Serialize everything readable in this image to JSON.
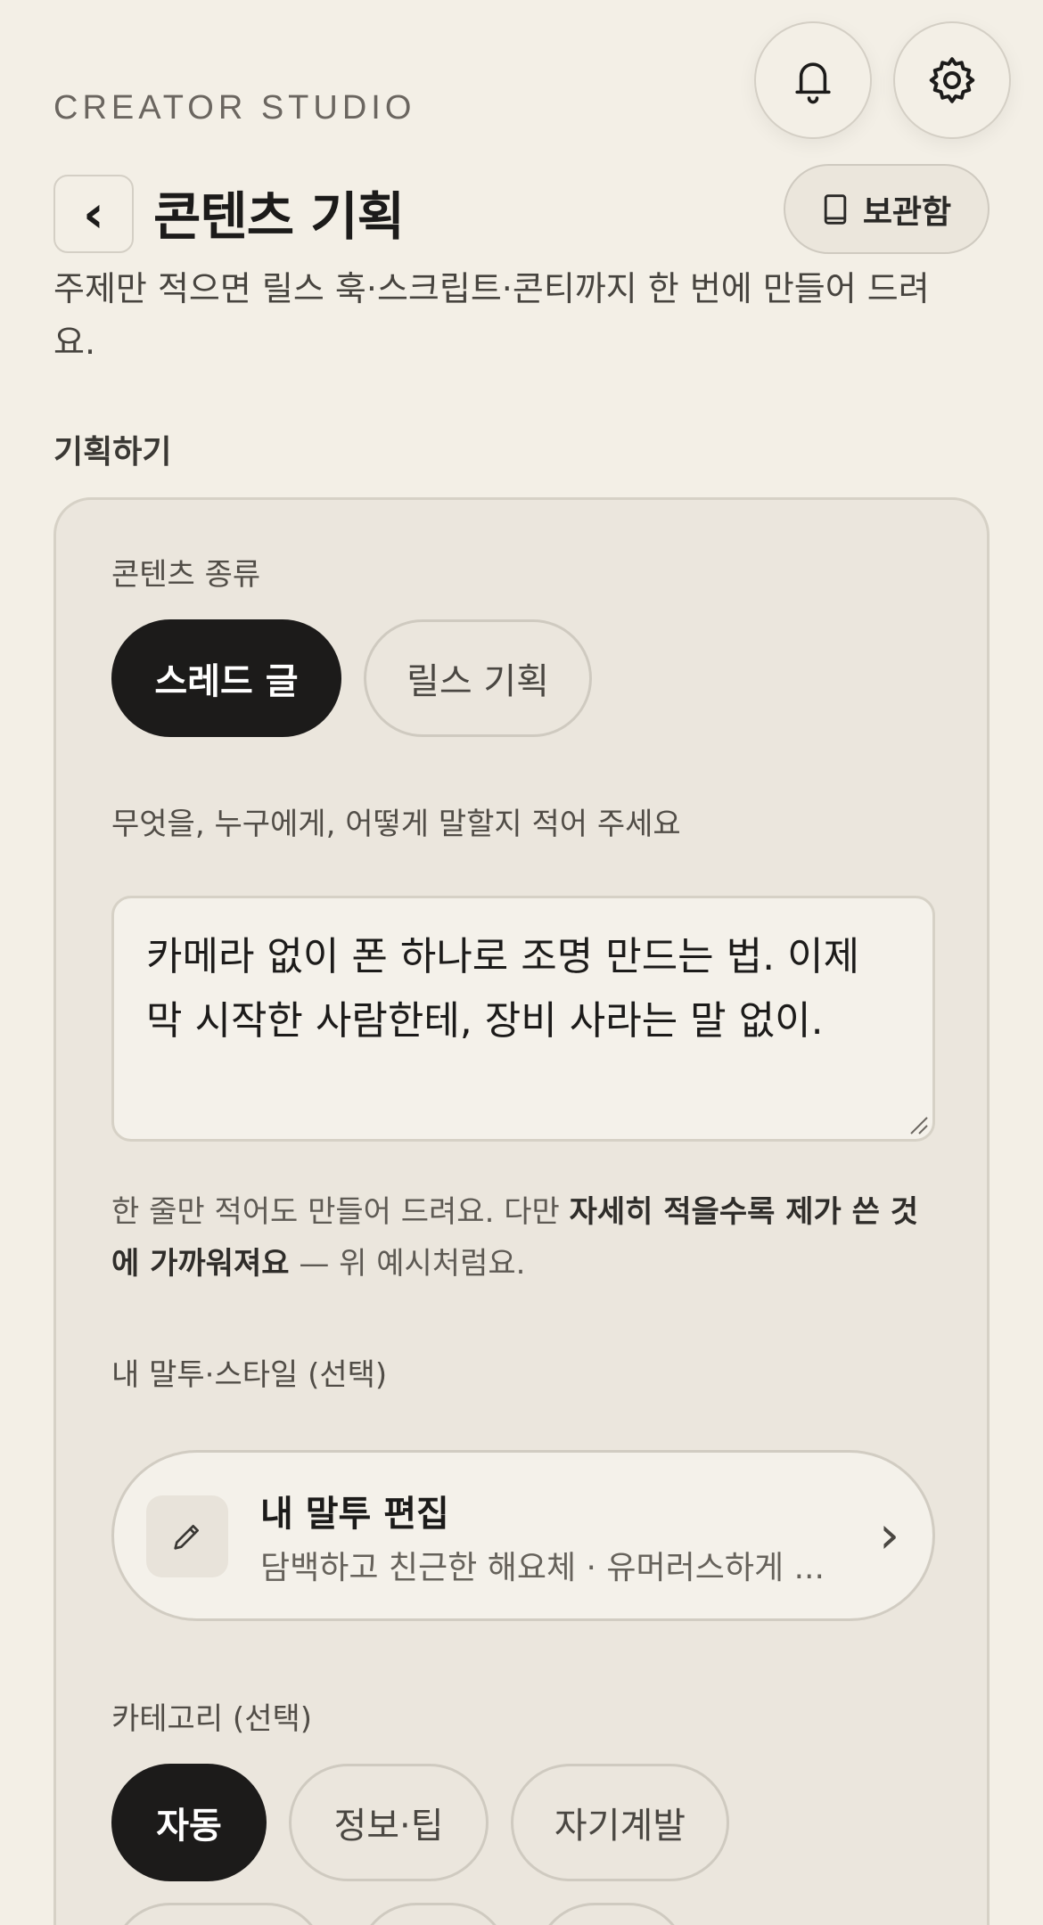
{
  "header": {
    "eyebrow": "CREATOR STUDIO",
    "notification_icon": "bell-icon",
    "settings_icon": "gear-icon",
    "back_label": "‹",
    "title": "콘텐츠 기획",
    "archive_label": "보관함",
    "archive_icon": "book-icon",
    "description": "주제만 적으면 릴스 훅·스크립트·콘티까지 한 번에 만들어 드려요."
  },
  "section": {
    "title": "기획하기"
  },
  "form": {
    "content_type": {
      "label": "콘텐츠 종류",
      "options": [
        "스레드 글",
        "릴스 기획"
      ],
      "selected": "스레드 글"
    },
    "prompt": {
      "label": "무엇을, 누구에게, 어떻게 말할지 적어 주세요",
      "value": "카메라 없이 폰 하나로 조명 만드는 법. 이제 막 시작한 사람한테, 장비 사라는 말 없이."
    },
    "hint": {
      "prefix": "한 줄만 적어도 만들어 드려요. 다만 ",
      "emphasis": "자세히 적을수록 제가 쓴 것에 가까워져요",
      "suffix": " — 위 예시처럼요."
    },
    "tone": {
      "label": "내 말투·스타일 (선택)",
      "title": "내 말투 편집",
      "subtitle": "담백하고 친근한 해요체 · 유머러스하게 ...",
      "icon": "pencil-icon",
      "chevron": "›"
    },
    "category": {
      "label": "카테고리 (선택)",
      "options": [
        "자동",
        "정보·팁",
        "자기계발"
      ],
      "selected": "자동"
    }
  },
  "colors": {
    "background": "#f3efe6",
    "card": "#ebe6dd",
    "accent": "#1c1b1a"
  }
}
